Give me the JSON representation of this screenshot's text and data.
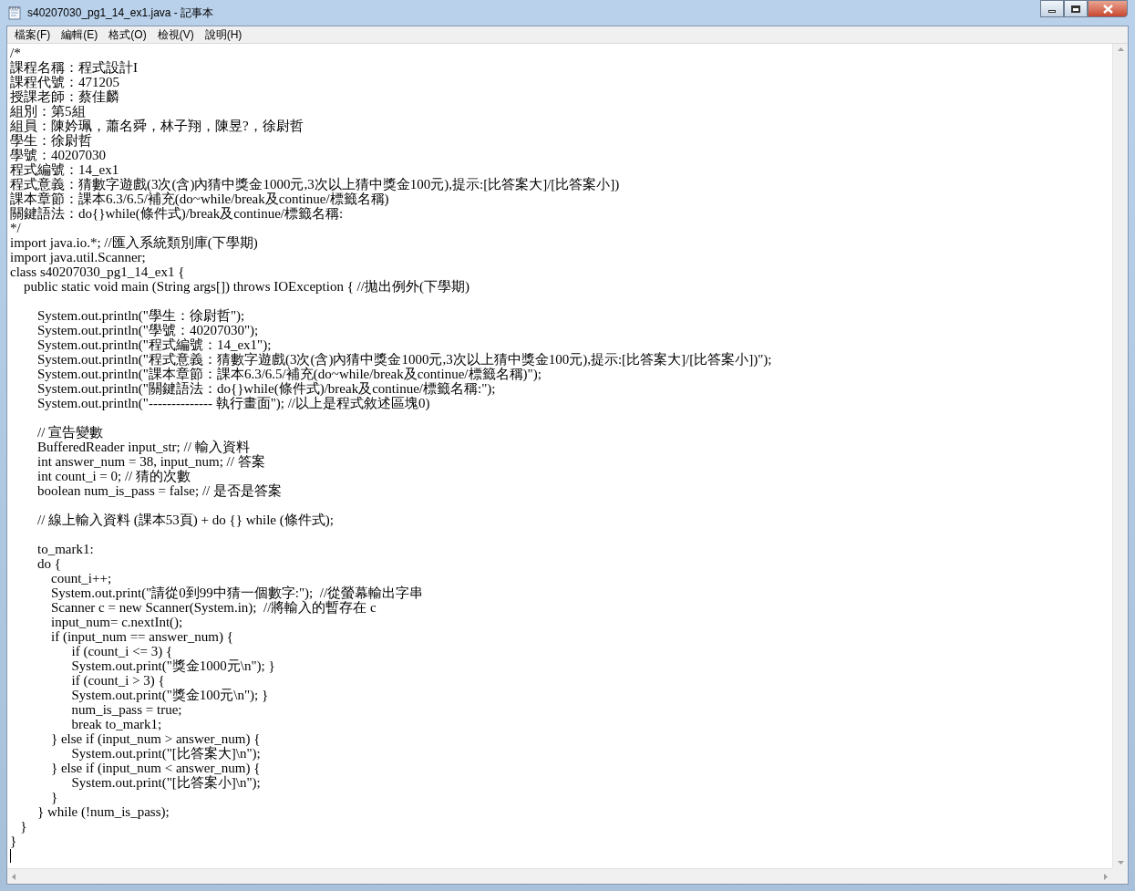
{
  "window": {
    "title": "s40207030_pg1_14_ex1.java - 記事本"
  },
  "menu": [
    "檔案(F)",
    "編輯(E)",
    "格式(O)",
    "檢視(V)",
    "說明(H)"
  ],
  "editor": {
    "blocks": [
      [
        "/*",
        "課程名稱：程式設計I",
        "課程代號：471205",
        "授課老師：蔡佳麟",
        "組別：第5組",
        "組員：陳妗珮，蕭名舜，林子翔，陳昱?，徐尉哲",
        "學生：徐尉哲",
        "學號：40207030",
        "程式編號：14_ex1",
        "程式意義：猜數字遊戲(3次(含)內猜中獎金1000元,3次以上猜中獎金100元),提示:[比答案大]/[比答案小])",
        "課本章節：課本6.3/6.5/補充(do~while/break及continue/標籤名稱)",
        "關鍵語法：do{}while(條件式)/break及continue/標籤名稱:",
        "*/",
        "import java.io.*; //匯入系統類別庫(下學期)",
        "import java.util.Scanner;",
        "class s40207030_pg1_14_ex1 {",
        "    public static void main (String args[]) throws IOException { //拋出例外(下學期)"
      ],
      [
        "        System.out.println(\"學生：徐尉哲\");",
        "        System.out.println(\"學號：40207030\");",
        "        System.out.println(\"程式編號：14_ex1\");",
        "        System.out.println(\"程式意義：猜數字遊戲(3次(含)內猜中獎金1000元,3次以上猜中獎金100元),提示:[比答案大]/[比答案小])\");",
        "        System.out.println(\"課本章節：課本6.3/6.5/補充(do~while/break及continue/標籤名稱)\");",
        "        System.out.println(\"關鍵語法：do{}while(條件式)/break及continue/標籤名稱:\");",
        "        System.out.println(\"-------------- 執行畫面\"); //以上是程式敘述區塊0)"
      ],
      [
        "        // 宣告變數",
        "        BufferedReader input_str; // 輸入資料",
        "        int answer_num = 38, input_num; // 答案",
        "        int count_i = 0; // 猜的次數",
        "        boolean num_is_pass = false; // 是否是答案"
      ],
      [
        "        // 線上輸入資料 (課本53頁) + do {} while (條件式);"
      ],
      [
        "        to_mark1:",
        "        do {",
        "            count_i++;",
        "            System.out.print(\"請從0到99中猜一個數字:\");  //從螢幕輸出字串",
        "            Scanner c = new Scanner(System.in);  //將輸入的暫存在 c",
        "            input_num= c.nextInt();",
        "            if (input_num == answer_num) {",
        "                  if (count_i <= 3) {",
        "                  System.out.print(\"獎金1000元\\n\"); }",
        "                  if (count_i > 3) {",
        "                  System.out.print(\"獎金100元\\n\"); }",
        "                  num_is_pass = true;",
        "                  break to_mark1;",
        "            } else if (input_num > answer_num) {",
        "                  System.out.print(\"[比答案大]\\n\");",
        "            } else if (input_num < answer_num) {",
        "                  System.out.print(\"[比答案小]\\n\");",
        "            }",
        "        } while (!num_is_pass);",
        "   }",
        "}"
      ]
    ]
  }
}
